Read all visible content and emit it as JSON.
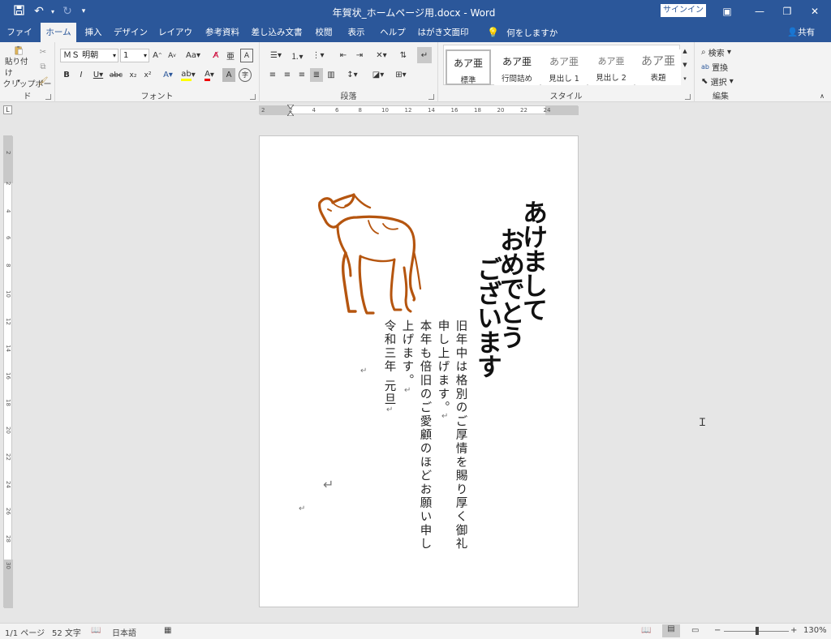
{
  "titlebar": {
    "title": "年賀状_ホームページ用.docx - Word",
    "signin": "サインイン",
    "save_icon": "save-icon",
    "undo_icon": "undo-icon",
    "redo_icon": "redo-icon"
  },
  "tabs": [
    {
      "label": "ファイル"
    },
    {
      "label": "ホーム"
    },
    {
      "label": "挿入"
    },
    {
      "label": "デザイン"
    },
    {
      "label": "レイアウト"
    },
    {
      "label": "参考資料"
    },
    {
      "label": "差し込み文書"
    },
    {
      "label": "校閲"
    },
    {
      "label": "表示"
    },
    {
      "label": "ヘルプ"
    },
    {
      "label": "はがき文面印刷"
    }
  ],
  "tellme": "何をしますか",
  "share": "共有",
  "ribbon": {
    "clipboard": {
      "paste": "貼り付け",
      "label": "クリップボード"
    },
    "font": {
      "name": "ＭＳ 明朝",
      "size": "1",
      "label": "フォント"
    },
    "paragraph": {
      "label": "段落"
    },
    "styles": {
      "label": "スタイル",
      "items": [
        {
          "sample": "あア亜",
          "name": "標準"
        },
        {
          "sample": "あア亜",
          "name": "行間詰め"
        },
        {
          "sample": "あア亜",
          "name": "見出し 1"
        },
        {
          "sample": "あア亜",
          "name": "見出し 2"
        },
        {
          "sample": "あア亜",
          "name": "表題"
        }
      ]
    },
    "editing": {
      "find": "検索",
      "replace": "置換",
      "select": "選択",
      "label": "編集"
    }
  },
  "document": {
    "greeting_col1": "あけまして",
    "greeting_col2": "おめでとう",
    "greeting_col3": "ございます",
    "body_col1": "旧年中は格別のご厚情を賜り厚く御礼",
    "body_col2": "申し上げます。",
    "body_col3": "本年も倍旧のご愛顧のほどお願い申し",
    "body_col4": "上げます。",
    "body_col5": "令和三年 元旦",
    "ox_color": "#b5550f"
  },
  "statusbar": {
    "page": "1/1 ページ",
    "words": "52 文字",
    "language": "日本語",
    "zoom": "130%"
  }
}
